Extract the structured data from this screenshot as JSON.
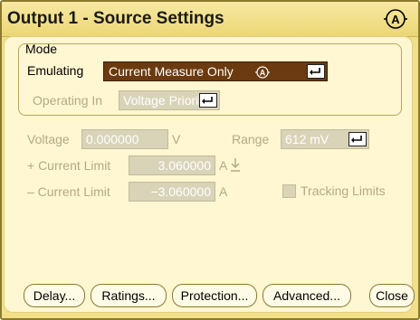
{
  "window": {
    "title": "Output 1 - Source Settings",
    "title_icon": "output-a-icon"
  },
  "mode": {
    "group_label": "Mode",
    "emulating_label": "Emulating",
    "emulating_value": "Current Measure Only",
    "operating_label": "Operating In",
    "operating_value": "Voltage Priority"
  },
  "settings": {
    "voltage_label": "Voltage",
    "voltage_value": "0.000000",
    "voltage_unit": "V",
    "range_label": "Range",
    "range_value": "612 mV",
    "pos_current_label": "+ Current Limit",
    "pos_current_value": "3.060000",
    "pos_current_unit": "A",
    "neg_current_label": "– Current Limit",
    "neg_current_value": "−3.060000",
    "neg_current_unit": "A",
    "tracking_label": "Tracking Limits"
  },
  "buttons": {
    "delay": "Delay...",
    "ratings": "Ratings...",
    "protection": "Protection...",
    "advanced": "Advanced...",
    "close": "Close"
  },
  "colors": {
    "title_bg": "#ecd675",
    "client_bg": "#fff7d1",
    "selected_bg": "#6b3a0e",
    "disabled_text": "#b3aa84"
  }
}
